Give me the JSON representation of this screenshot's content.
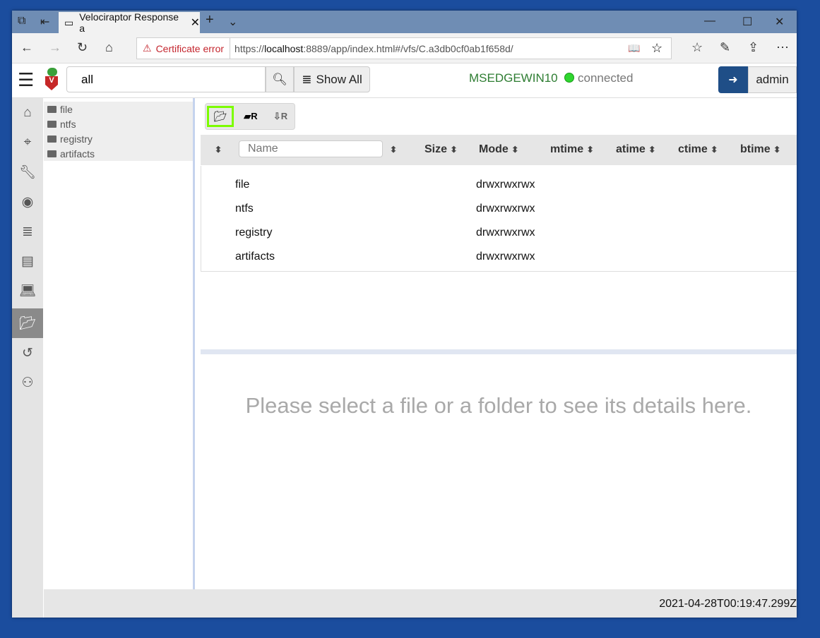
{
  "browser": {
    "tab_title": "Velociraptor Response a",
    "cert_error": "Certificate error",
    "url_prefix": "https://",
    "url_host": "localhost",
    "url_rest": ":8889/app/index.html#/vfs/C.a3db0cf0ab1f658d/"
  },
  "header": {
    "search_value": "all",
    "show_all": "Show All",
    "hostname": "MSEDGEWIN10",
    "status": "connected",
    "user": "admin"
  },
  "tree": [
    {
      "label": "file"
    },
    {
      "label": "ntfs"
    },
    {
      "label": "registry"
    },
    {
      "label": "artifacts"
    }
  ],
  "table": {
    "name_placeholder": "Name",
    "columns": {
      "size": "Size",
      "mode": "Mode",
      "mtime": "mtime",
      "atime": "atime",
      "ctime": "ctime",
      "btime": "btime"
    },
    "rows": [
      {
        "name": "file",
        "mode": "drwxrwxrwx"
      },
      {
        "name": "ntfs",
        "mode": "drwxrwxrwx"
      },
      {
        "name": "registry",
        "mode": "drwxrwxrwx"
      },
      {
        "name": "artifacts",
        "mode": "drwxrwxrwx"
      }
    ]
  },
  "details_placeholder": "Please select a file or a folder to see its details here.",
  "footer": {
    "timestamp": "2021-04-28T00:19:47.299Z"
  },
  "colors": {
    "hostname": "#2e7d32",
    "accent": "#1f4e87",
    "highlight": "#7cfc00"
  }
}
